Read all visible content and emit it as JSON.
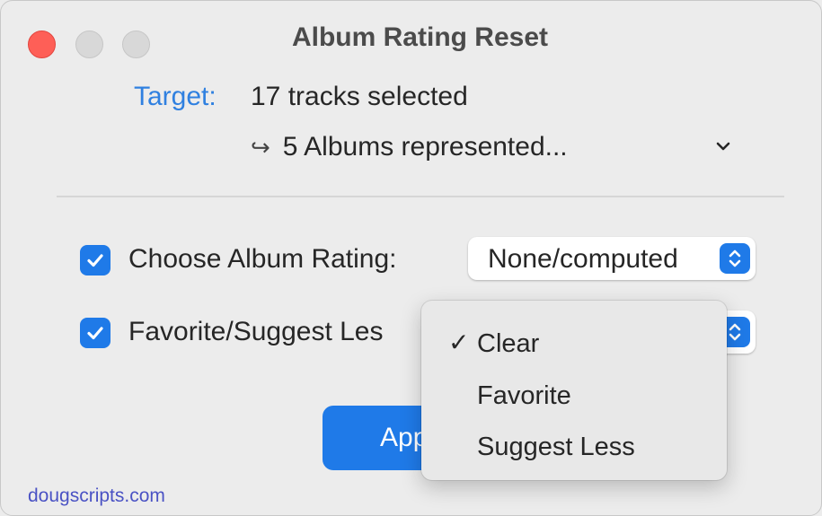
{
  "window": {
    "title": "Album Rating Reset"
  },
  "target": {
    "label": "Target:",
    "value": "17 tracks selected",
    "albums_text": "5 Albums represented...",
    "albums_arrow": "↪"
  },
  "options": {
    "album_rating": {
      "label": "Choose Album Rating:",
      "checked": true,
      "selected": "None/computed"
    },
    "favorite": {
      "label": "Favorite/Suggest Les",
      "checked": true
    }
  },
  "menu": {
    "items": [
      {
        "label": "Clear",
        "checked": true,
        "check_glyph": "✓"
      },
      {
        "label": "Favorite",
        "checked": false
      },
      {
        "label": "Suggest Less",
        "checked": false
      }
    ]
  },
  "apply_button": {
    "label": "App"
  },
  "footer": {
    "text": "dougscripts.com"
  },
  "colors": {
    "accent": "#1f7ae8",
    "target_label": "#2f80e0",
    "close": "#fe5f57",
    "footer_link": "#4a52c4"
  }
}
